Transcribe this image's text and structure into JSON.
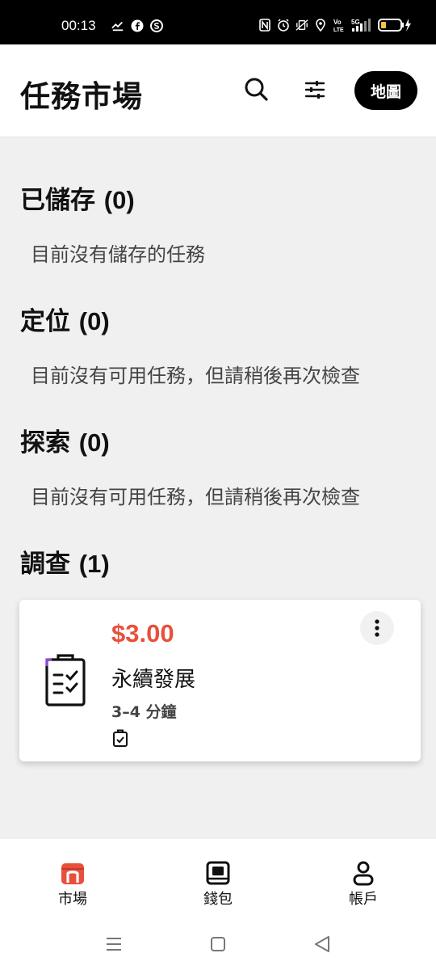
{
  "status_bar": {
    "time": "00:13",
    "left_icons": [
      "missed-call-icon",
      "facebook-icon",
      "app-notification-icon"
    ],
    "right_icons": [
      "nfc-icon",
      "alarm-icon",
      "vibrate-icon",
      "location-icon",
      "volte-icon",
      "signal-5g-icon",
      "battery-icon"
    ],
    "network_label": "5G"
  },
  "header": {
    "title": "任務市場",
    "map_label": "地圖"
  },
  "sections": [
    {
      "title": "已儲存",
      "count": "(0)",
      "message": "目前沒有儲存的任務"
    },
    {
      "title": "定位",
      "count": "(0)",
      "message": "目前沒有可用任務，但請稍後再次檢查"
    },
    {
      "title": "探索",
      "count": "(0)",
      "message": "目前沒有可用任務，但請稍後再次檢查"
    },
    {
      "title": "調查",
      "count": "(1)"
    }
  ],
  "task": {
    "price": "$3.00",
    "name": "永續發展",
    "duration": "3–4 分鐘"
  },
  "bottom_nav": {
    "items": [
      {
        "label": "市場",
        "icon": "market-icon",
        "active": true
      },
      {
        "label": "錢包",
        "icon": "wallet-icon",
        "active": false
      },
      {
        "label": "帳戶",
        "icon": "account-icon",
        "active": false
      }
    ]
  },
  "colors": {
    "accent": "#e8503c",
    "background": "#f0f0f0",
    "map_button": "#000000"
  }
}
